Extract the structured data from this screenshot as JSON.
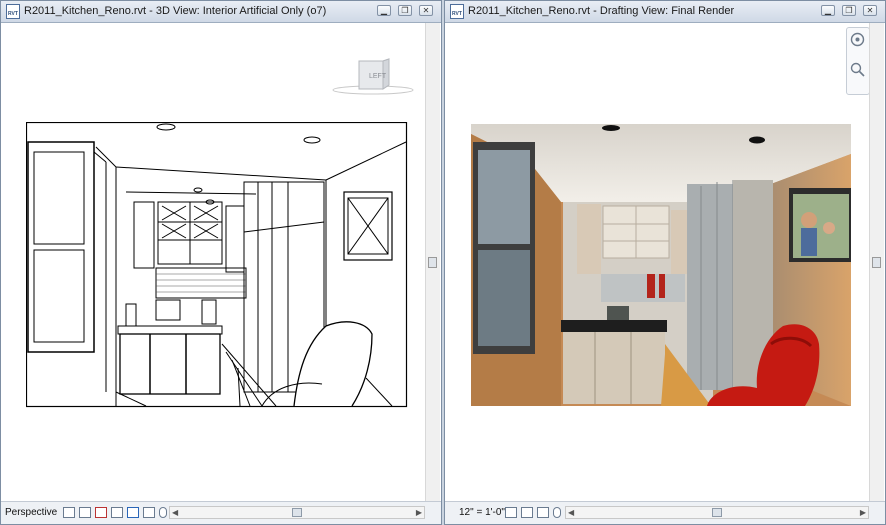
{
  "left_window": {
    "title": "R2011_Kitchen_Reno.rvt - 3D View: Interior Artificial Only (o7)",
    "viewcube_label": "LEFT",
    "status_label": "Perspective",
    "file_icon": "RVT"
  },
  "right_window": {
    "title": "R2011_Kitchen_Reno.rvt - Drafting View: Final Render",
    "scale_label": "12\" = 1'-0\"",
    "file_icon": "RVT"
  },
  "icons": {
    "minimize": "minimize-icon",
    "restore": "restore-icon",
    "close": "close-icon",
    "steering_wheel": "steering-wheel-icon",
    "zoom": "zoom-icon"
  },
  "colors": {
    "title_bar": "#d8e1ec",
    "render_wall": "#c8894f",
    "chair": "#c51a12"
  }
}
